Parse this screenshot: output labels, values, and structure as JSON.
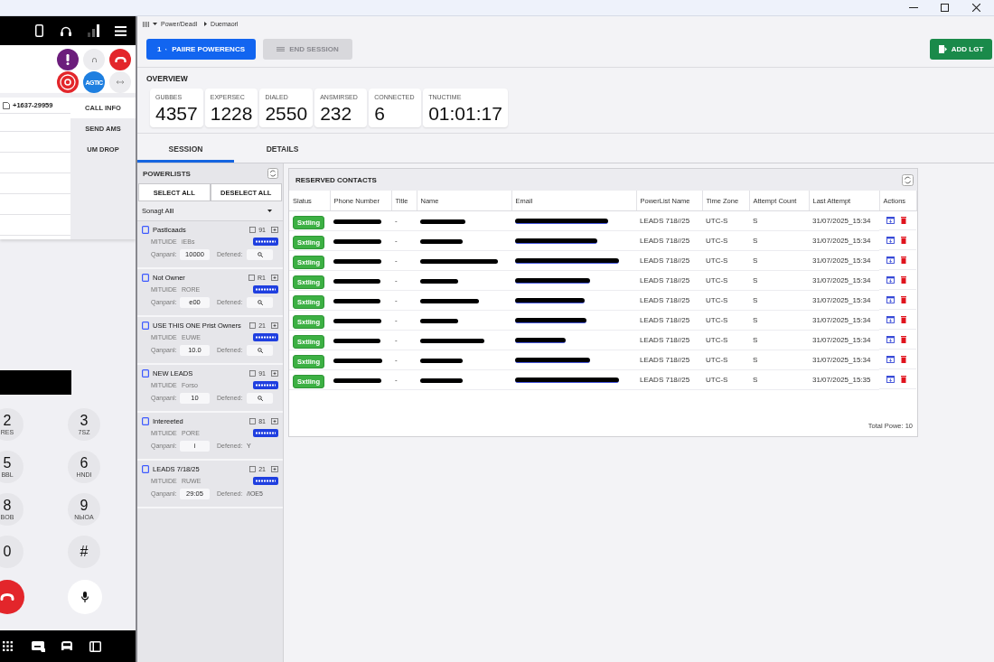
{
  "window": {
    "controls": [
      {
        "kind": "minimize"
      },
      {
        "kind": "maximize"
      },
      {
        "kind": "close"
      }
    ]
  },
  "phone": {
    "header_icons": [
      {
        "kind": "phone"
      },
      {
        "kind": "headset"
      },
      {
        "kind": "signal"
      },
      {
        "kind": "menu"
      }
    ],
    "actions": [
      {
        "kind": "alert"
      },
      {
        "kind": "arch"
      },
      {
        "kind": "hangup"
      },
      {
        "kind": "record"
      },
      {
        "kind": "agent",
        "label": "AGTIC"
      },
      {
        "kind": "transfer"
      }
    ],
    "caller_number": "+1637-29959",
    "side_tabs": [
      {
        "label": "CALL INFO",
        "selected": true
      },
      {
        "label": "SEND AMS",
        "selected": false
      },
      {
        "label": "UM DROP",
        "selected": false
      }
    ],
    "keypad": [
      {
        "digit": "2",
        "letters": "RES"
      },
      {
        "digit": "3",
        "letters": "7SZ"
      },
      {
        "digit": "5",
        "letters": "BBL"
      },
      {
        "digit": "6",
        "letters": "HNDI"
      },
      {
        "digit": "8",
        "letters": "BOB"
      },
      {
        "digit": "9",
        "letters": "NЫOA"
      },
      {
        "digit": "0"
      },
      {
        "digit": "#"
      }
    ],
    "call_controls": [
      {
        "kind": "hangup"
      },
      {
        "kind": "mic"
      }
    ],
    "taskbar": [
      {
        "kind": "grid"
      },
      {
        "kind": "chat"
      },
      {
        "kind": "car"
      },
      {
        "kind": "panel"
      }
    ]
  },
  "breadcrumb": [
    "Power/Deadl",
    "Duemaorl"
  ],
  "toolbar": {
    "start": {
      "prefix": "1",
      "label": "PAIIRE POWERENCS"
    },
    "end": {
      "label": "END SESSION",
      "disabled": true
    },
    "add": {
      "label": "ADD LGT"
    }
  },
  "overview": {
    "title": "OVERVIEW",
    "stats": [
      {
        "label": "GUBBES",
        "value": "4357"
      },
      {
        "label": "EXPERSEC",
        "value": "1228"
      },
      {
        "label": "DIALED",
        "value": "2550"
      },
      {
        "label": "ANSMIRSED",
        "value": "232"
      },
      {
        "label": "CONNECTED",
        "value": "6"
      },
      {
        "label": "TNUCTIME",
        "value": "01:01:17"
      }
    ]
  },
  "tabs": [
    {
      "label": "SESSION",
      "selected": true
    },
    {
      "label": "DETAILS",
      "selected": false
    }
  ],
  "powerlists": {
    "title": "POWERLISTS",
    "select_all": "SELECT ALL",
    "deselect_all": "DESELECT ALL",
    "filter": "Sonagt Alll",
    "items": [
      {
        "name": "Pastlcaads",
        "checked": false,
        "count": "91",
        "minute_label": "MITUIDE",
        "minute_value": "iEBs",
        "campaign_label": "Qanpanl:",
        "campaign": "10000",
        "defended_label": "Defened:",
        "defended": {
          "kind": "search"
        }
      },
      {
        "name": "Not Owner",
        "checked": false,
        "count": "R1",
        "minute_label": "MITUIDE",
        "minute_value": "RORE",
        "campaign_label": "Qanpanl:",
        "campaign": "e00",
        "defended_label": "Defened:",
        "defended": {
          "kind": "search"
        }
      },
      {
        "name": "USE THIS ONE Prist Owners",
        "checked": false,
        "count": "21",
        "minute_label": "MITUIDE",
        "minute_value": "EUWE",
        "campaign_label": "Qanpanl:",
        "campaign": "10.0",
        "defended_label": "Defened:",
        "defended": {
          "kind": "search"
        }
      },
      {
        "name": "NEW LEADS",
        "checked": false,
        "count": "91",
        "minute_label": "MITUIDE",
        "minute_value": "Forso",
        "campaign_label": "Qanpanl:",
        "campaign": "10",
        "defended_label": "Defened:",
        "defended": {
          "kind": "search"
        }
      },
      {
        "name": "Intereeted",
        "checked": false,
        "count": "81",
        "minute_label": "MITUIDE",
        "minute_value": "PORE",
        "campaign_label": "Qanpanl:",
        "campaign": "i",
        "defended_label": "Defened:",
        "defended": {
          "kind": "text",
          "text": "Y"
        }
      },
      {
        "name": "LEADS 7/18/25",
        "checked": false,
        "count": "21",
        "minute_label": "MITUIDE",
        "minute_value": "RUWE",
        "campaign_label": "Qanpanl:",
        "campaign": "29:05",
        "defended_label": "Defened:",
        "defended": {
          "kind": "text",
          "text": "/IOE5"
        }
      }
    ]
  },
  "contacts": {
    "title": "RESERVED CONTACTS",
    "columns": [
      "Slatus",
      "Phone Number",
      "Title",
      "Name",
      "Email",
      "PowerList Name",
      "Time Zone",
      "Attempt Count",
      "Last Attempt",
      "Actions"
    ],
    "rows": [
      {
        "status": "Sxtling",
        "title": "-",
        "powerlist": "LEADS 718//25",
        "time_zone": "UTC-S",
        "attempts": "S",
        "last_attempt": "31/07/2025_15:34"
      },
      {
        "status": "Sxtling",
        "title": "-",
        "powerlist": "LEADS 718//25",
        "time_zone": "UTC-S",
        "attempts": "S",
        "last_attempt": "31/07/2025_15:34"
      },
      {
        "status": "Sxtling",
        "title": "-",
        "powerlist": "LEADS 718//25",
        "time_zone": "UTC-S",
        "attempts": "S",
        "last_attempt": "31/07/2025_15:34"
      },
      {
        "status": "Sxtling",
        "title": "-",
        "powerlist": "LEADS 718//25",
        "time_zone": "UTC-S",
        "attempts": "S",
        "last_attempt": "31/07/2025_15:34"
      },
      {
        "status": "Sxtling",
        "title": "-",
        "powerlist": "LEADS 718//25",
        "time_zone": "UTC-S",
        "attempts": "S",
        "last_attempt": "31/07/2025_15:34"
      },
      {
        "status": "Sxtling",
        "title": "-",
        "powerlist": "LEADS 718//25",
        "time_zone": "UTC-S",
        "attempts": "S",
        "last_attempt": "31/07/2025_15:34"
      },
      {
        "status": "Sxtling",
        "title": "-",
        "powerlist": "LEADS 718//25",
        "time_zone": "UTC-S",
        "attempts": "S",
        "last_attempt": "31/07/2025_15:34"
      },
      {
        "status": "Sxtling",
        "title": "-",
        "powerlist": "LEADS 718//25",
        "time_zone": "UTC-S",
        "attempts": "S",
        "last_attempt": "31/07/2025_15:34"
      },
      {
        "status": "Sxtling",
        "title": "-",
        "powerlist": "LEADS 718//25",
        "time_zone": "UTC-S",
        "attempts": "S",
        "last_attempt": "31/07/2025_15:35"
      }
    ],
    "footer": "Total Powe: 10"
  }
}
